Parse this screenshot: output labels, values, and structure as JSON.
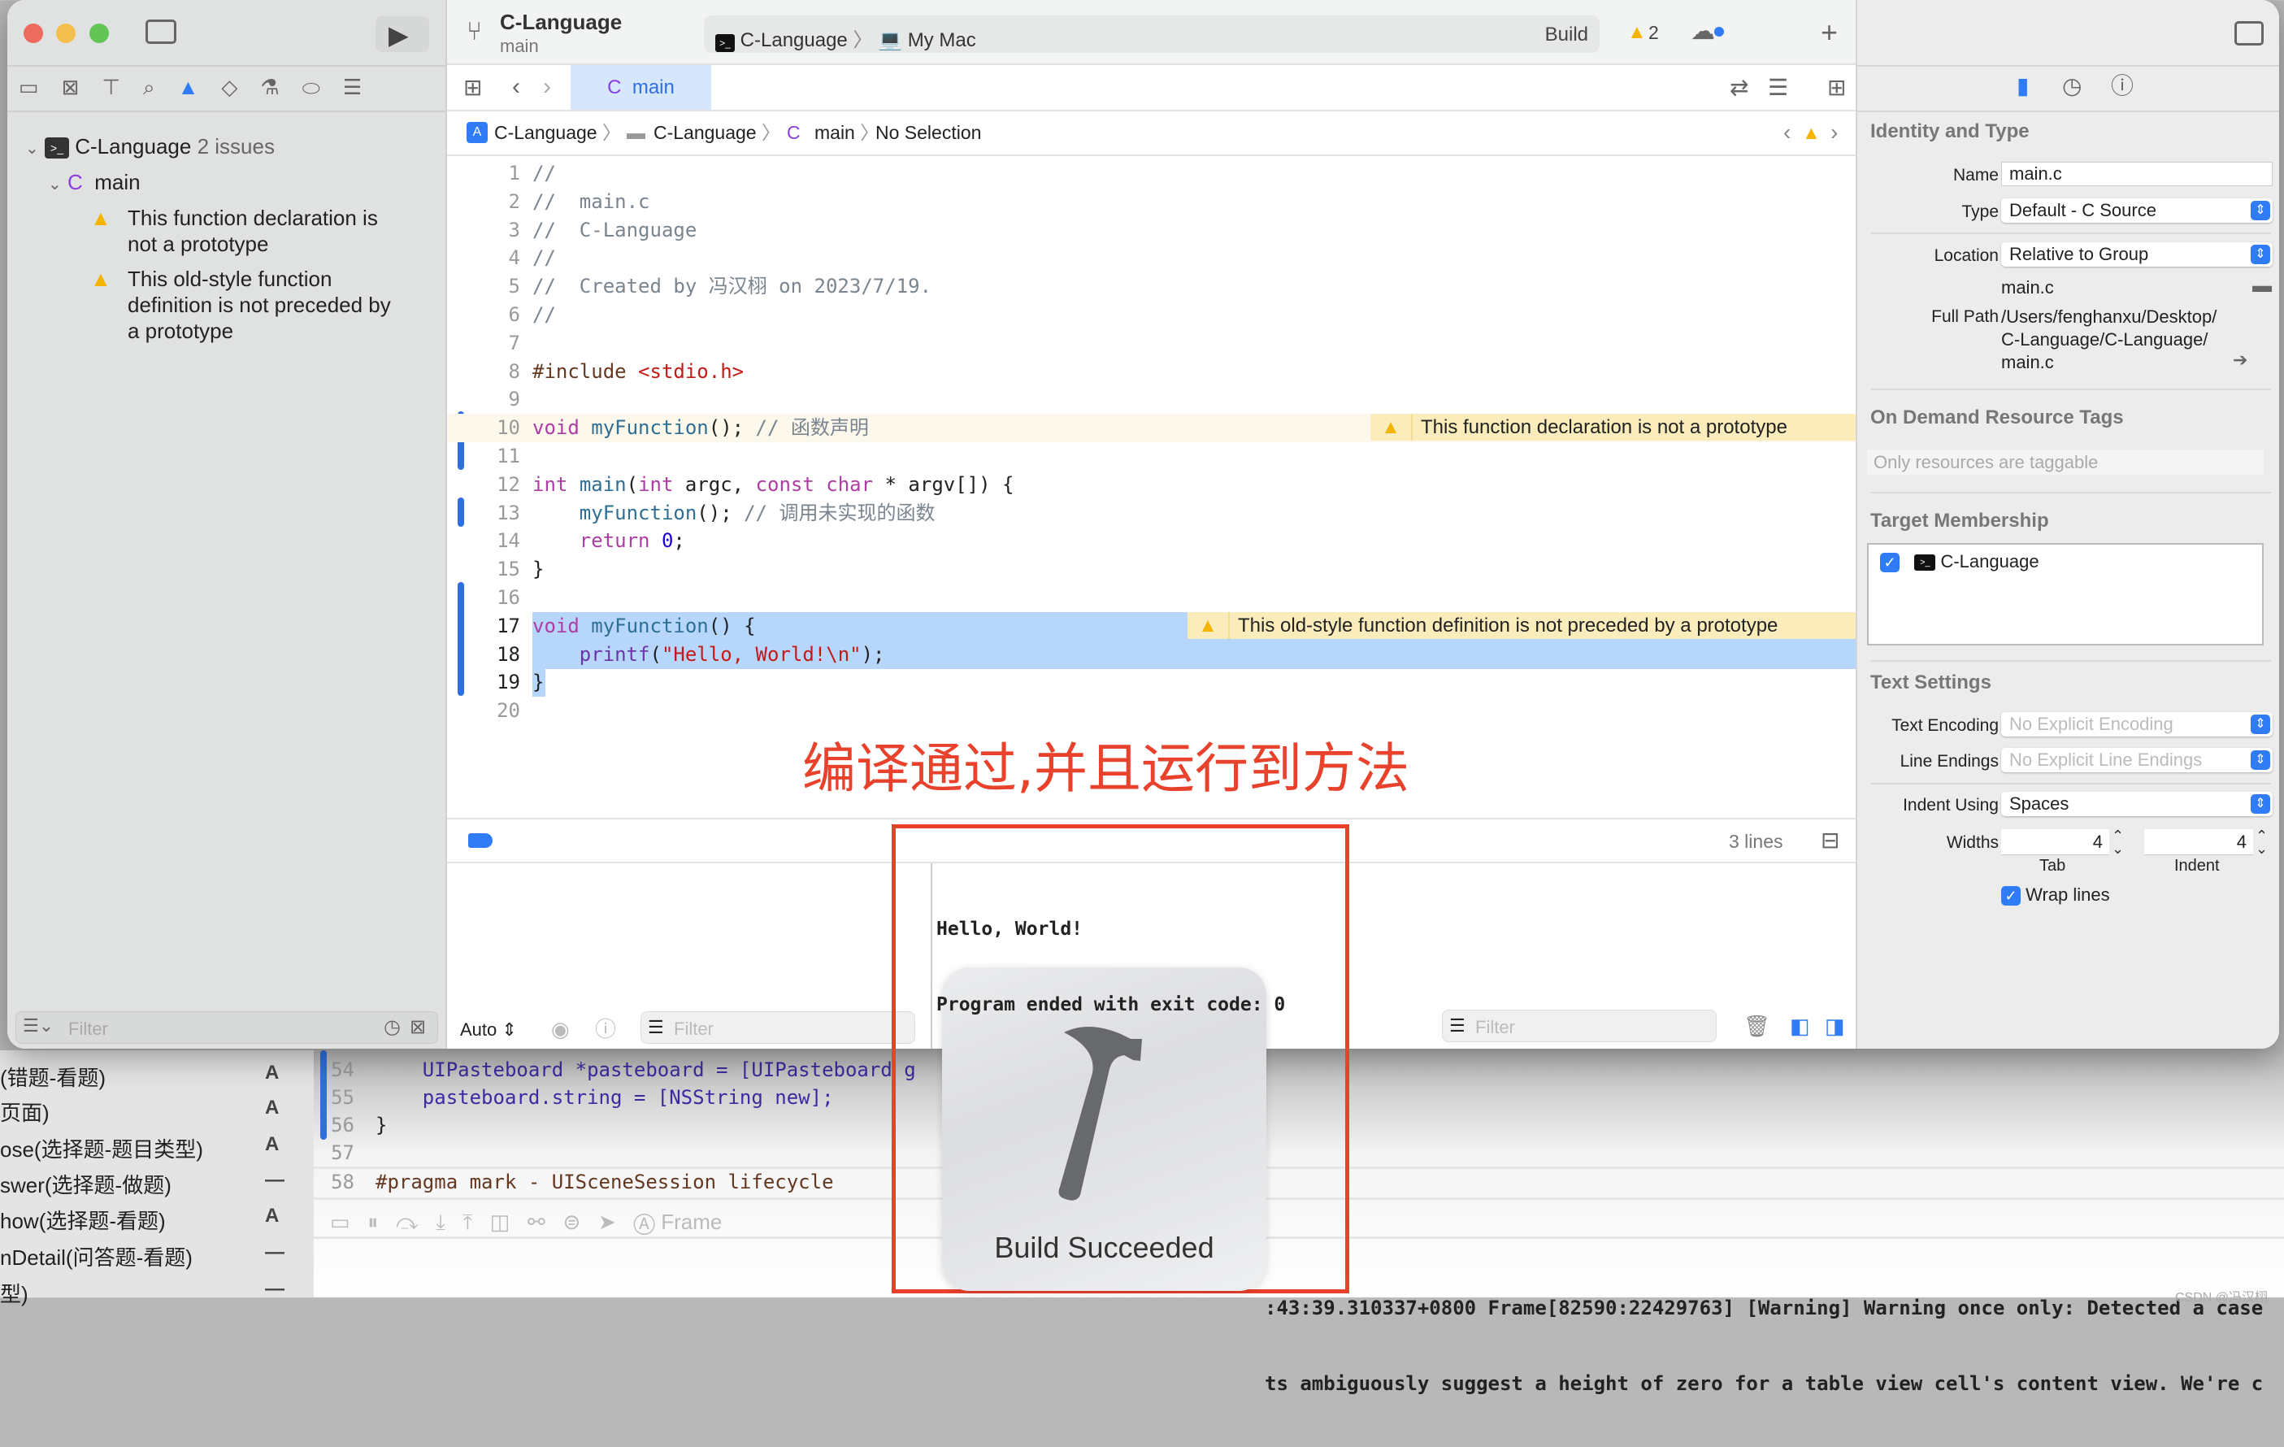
{
  "background_window": {
    "list_items": [
      {
        "label": "(错题-看题)",
        "badge": "A"
      },
      {
        "label": "页面)",
        "badge": "A"
      },
      {
        "label": "ose(选择题-题目类型)",
        "badge": "A"
      },
      {
        "label": "swer(选择题-做题)",
        "badge": "—"
      },
      {
        "label": "how(选择题-看题)",
        "badge": "A"
      },
      {
        "label": "nDetail(问答题-看题)",
        "badge": "—"
      },
      {
        "label": "型)",
        "badge": "—"
      }
    ],
    "code_lines": [
      {
        "num": "54",
        "text": "    UIPasteboard *pasteboard = [UIPasteboard g"
      },
      {
        "num": "55",
        "text": "    pasteboard.string = [NSString new];"
      },
      {
        "num": "56",
        "text": "}"
      },
      {
        "num": "57",
        "text": ""
      },
      {
        "num": "58",
        "text": "#pragma mark - UISceneSession lifecycle"
      }
    ],
    "debug_frame_label": "Frame",
    "log_lines": [
      ":43:39.310337+0800 Frame[82590:22429763] [Warning] Warning once only: Detected a case",
      "ts ambiguously suggest a height of zero for a table view cell's content view. We're c"
    ],
    "watermark": "CSDN @冯汉栩"
  },
  "toolbar": {
    "project": "C-Language",
    "branch": "main",
    "scheme": "C-Language",
    "destination": "My Mac",
    "status": "Build",
    "warning_count": "2"
  },
  "navigator": {
    "project": {
      "label": "C-Language",
      "issues": "2 issues"
    },
    "file": {
      "icon": "C",
      "label": "main"
    },
    "issues": [
      {
        "lines": [
          "This function declaration is",
          "not a prototype"
        ]
      },
      {
        "lines": [
          "This old-style function",
          "definition is not preceded by",
          "a prototype"
        ]
      }
    ],
    "filter_placeholder": "Filter"
  },
  "editor": {
    "tab": {
      "icon": "C",
      "label": "main"
    },
    "jumpbar": [
      "C-Language",
      "C-Language",
      "main",
      "No Selection"
    ],
    "jumpbar_file_icon": "C",
    "lines": [
      {
        "n": "1",
        "t": [
          [
            "//",
            "cm"
          ]
        ]
      },
      {
        "n": "2",
        "t": [
          [
            "//  main.c",
            "cm"
          ]
        ]
      },
      {
        "n": "3",
        "t": [
          [
            "//  C-Language",
            "cm"
          ]
        ]
      },
      {
        "n": "4",
        "t": [
          [
            "//",
            "cm"
          ]
        ]
      },
      {
        "n": "5",
        "t": [
          [
            "//  Created by 冯汉栩 on 2023/7/19.",
            "cm"
          ]
        ]
      },
      {
        "n": "6",
        "t": [
          [
            "//",
            "cm"
          ]
        ]
      },
      {
        "n": "7",
        "t": []
      },
      {
        "n": "8",
        "t": [
          [
            "#include ",
            "pp"
          ],
          [
            "<stdio.h>",
            "st"
          ]
        ]
      },
      {
        "n": "9",
        "t": []
      },
      {
        "n": "10",
        "t": [
          [
            "void",
            "kw"
          ],
          [
            " ",
            "pl"
          ],
          [
            "myFunction",
            "fn"
          ],
          [
            "();",
            "pl"
          ],
          [
            " // 函数声明",
            "cm"
          ]
        ],
        "warning": "This function declaration is not a prototype"
      },
      {
        "n": "11",
        "t": []
      },
      {
        "n": "12",
        "t": [
          [
            "int",
            "kw"
          ],
          [
            " ",
            "pl"
          ],
          [
            "main",
            "fn"
          ],
          [
            "(",
            "pl"
          ],
          [
            "int",
            "kw"
          ],
          [
            " argc, ",
            "pl"
          ],
          [
            "const",
            "kw"
          ],
          [
            " ",
            "pl"
          ],
          [
            "char",
            "kw"
          ],
          [
            " * argv[]) {",
            "pl"
          ]
        ]
      },
      {
        "n": "13",
        "t": [
          [
            "    ",
            "pl"
          ],
          [
            "myFunction",
            "fn"
          ],
          [
            "();",
            "pl"
          ],
          [
            " // 调用未实现的函数",
            "cm"
          ]
        ]
      },
      {
        "n": "14",
        "t": [
          [
            "    ",
            "pl"
          ],
          [
            "return",
            "kw"
          ],
          [
            " ",
            "pl"
          ],
          [
            "0",
            "nu"
          ],
          [
            ";",
            "pl"
          ]
        ]
      },
      {
        "n": "15",
        "t": [
          [
            "}",
            "pl"
          ]
        ]
      },
      {
        "n": "16",
        "t": []
      },
      {
        "n": "17",
        "t": [
          [
            "void",
            "kw"
          ],
          [
            " ",
            "pl"
          ],
          [
            "myFunction",
            "fn"
          ],
          [
            "() {",
            "pl"
          ]
        ],
        "warning": "This old-style function definition is not preceded by a prototype",
        "selected": true
      },
      {
        "n": "18",
        "t": [
          [
            "    ",
            "pl"
          ],
          [
            "printf",
            "lib"
          ],
          [
            "(",
            "pl"
          ],
          [
            "\"Hello, World!\\n\"",
            "st"
          ],
          [
            ");",
            "pl"
          ]
        ],
        "selected": true
      },
      {
        "n": "19",
        "t": [
          [
            "}",
            "pl"
          ]
        ],
        "selected": true
      },
      {
        "n": "20",
        "t": []
      }
    ],
    "annotation": "编译通过,并且运行到方法"
  },
  "debug": {
    "line_count": "3 lines",
    "console_output": [
      "Hello, World!",
      "Program ended with exit code: 0"
    ],
    "variables_mode": "Auto",
    "filter_placeholder": "Filter",
    "console_filter_placeholder": "Filter"
  },
  "hud": {
    "label": "Build Succeeded",
    "icon": "hammer-icon"
  },
  "inspector": {
    "identity": {
      "title": "Identity and Type",
      "name_label": "Name",
      "name": "main.c",
      "type_label": "Type",
      "type": "Default - C Source",
      "location_label": "Location",
      "location": "Relative to Group",
      "location_file": "main.c",
      "full_path_label": "Full Path",
      "full_path": [
        "/Users/fenghanxu/Desktop/",
        "C-Language/C-Language/",
        "main.c"
      ]
    },
    "tags": {
      "title": "On Demand Resource Tags",
      "placeholder": "Only resources are taggable"
    },
    "membership": {
      "title": "Target Membership",
      "targets": [
        {
          "label": "C-Language",
          "checked": true
        }
      ]
    },
    "text_settings": {
      "title": "Text Settings",
      "encoding_label": "Text Encoding",
      "encoding": "No Explicit Encoding",
      "line_endings_label": "Line Endings",
      "line_endings": "No Explicit Line Endings",
      "indent_using_label": "Indent Using",
      "indent_using": "Spaces",
      "widths_label": "Widths",
      "tab_width": "4",
      "indent_width": "4",
      "tab_label": "Tab",
      "indent_label": "Indent",
      "wrap_lines_label": "Wrap lines",
      "wrap_lines": true
    }
  },
  "colors": {
    "accent": "#2f7cf6",
    "warning": "#f5b400",
    "annotation": "#e8412c",
    "selection": "#b6d6fb"
  }
}
